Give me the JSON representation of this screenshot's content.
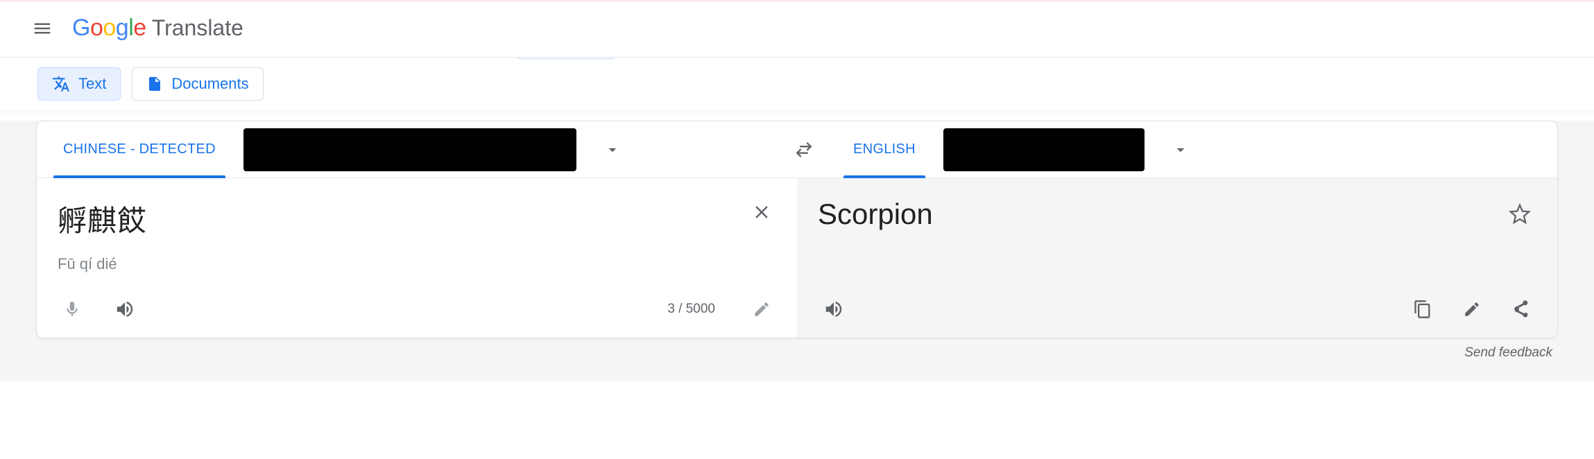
{
  "header": {
    "product": "Translate"
  },
  "modes": {
    "text_label": "Text",
    "documents_label": "Documents"
  },
  "lang_bar": {
    "source_active": "CHINESE - DETECTED",
    "target_active": "ENGLISH"
  },
  "source": {
    "text": "孵麒餀",
    "transliteration": "Fū qí dié",
    "char_count": "3 / 5000"
  },
  "target": {
    "text": "Scorpion"
  },
  "footer": {
    "feedback": "Send feedback"
  }
}
